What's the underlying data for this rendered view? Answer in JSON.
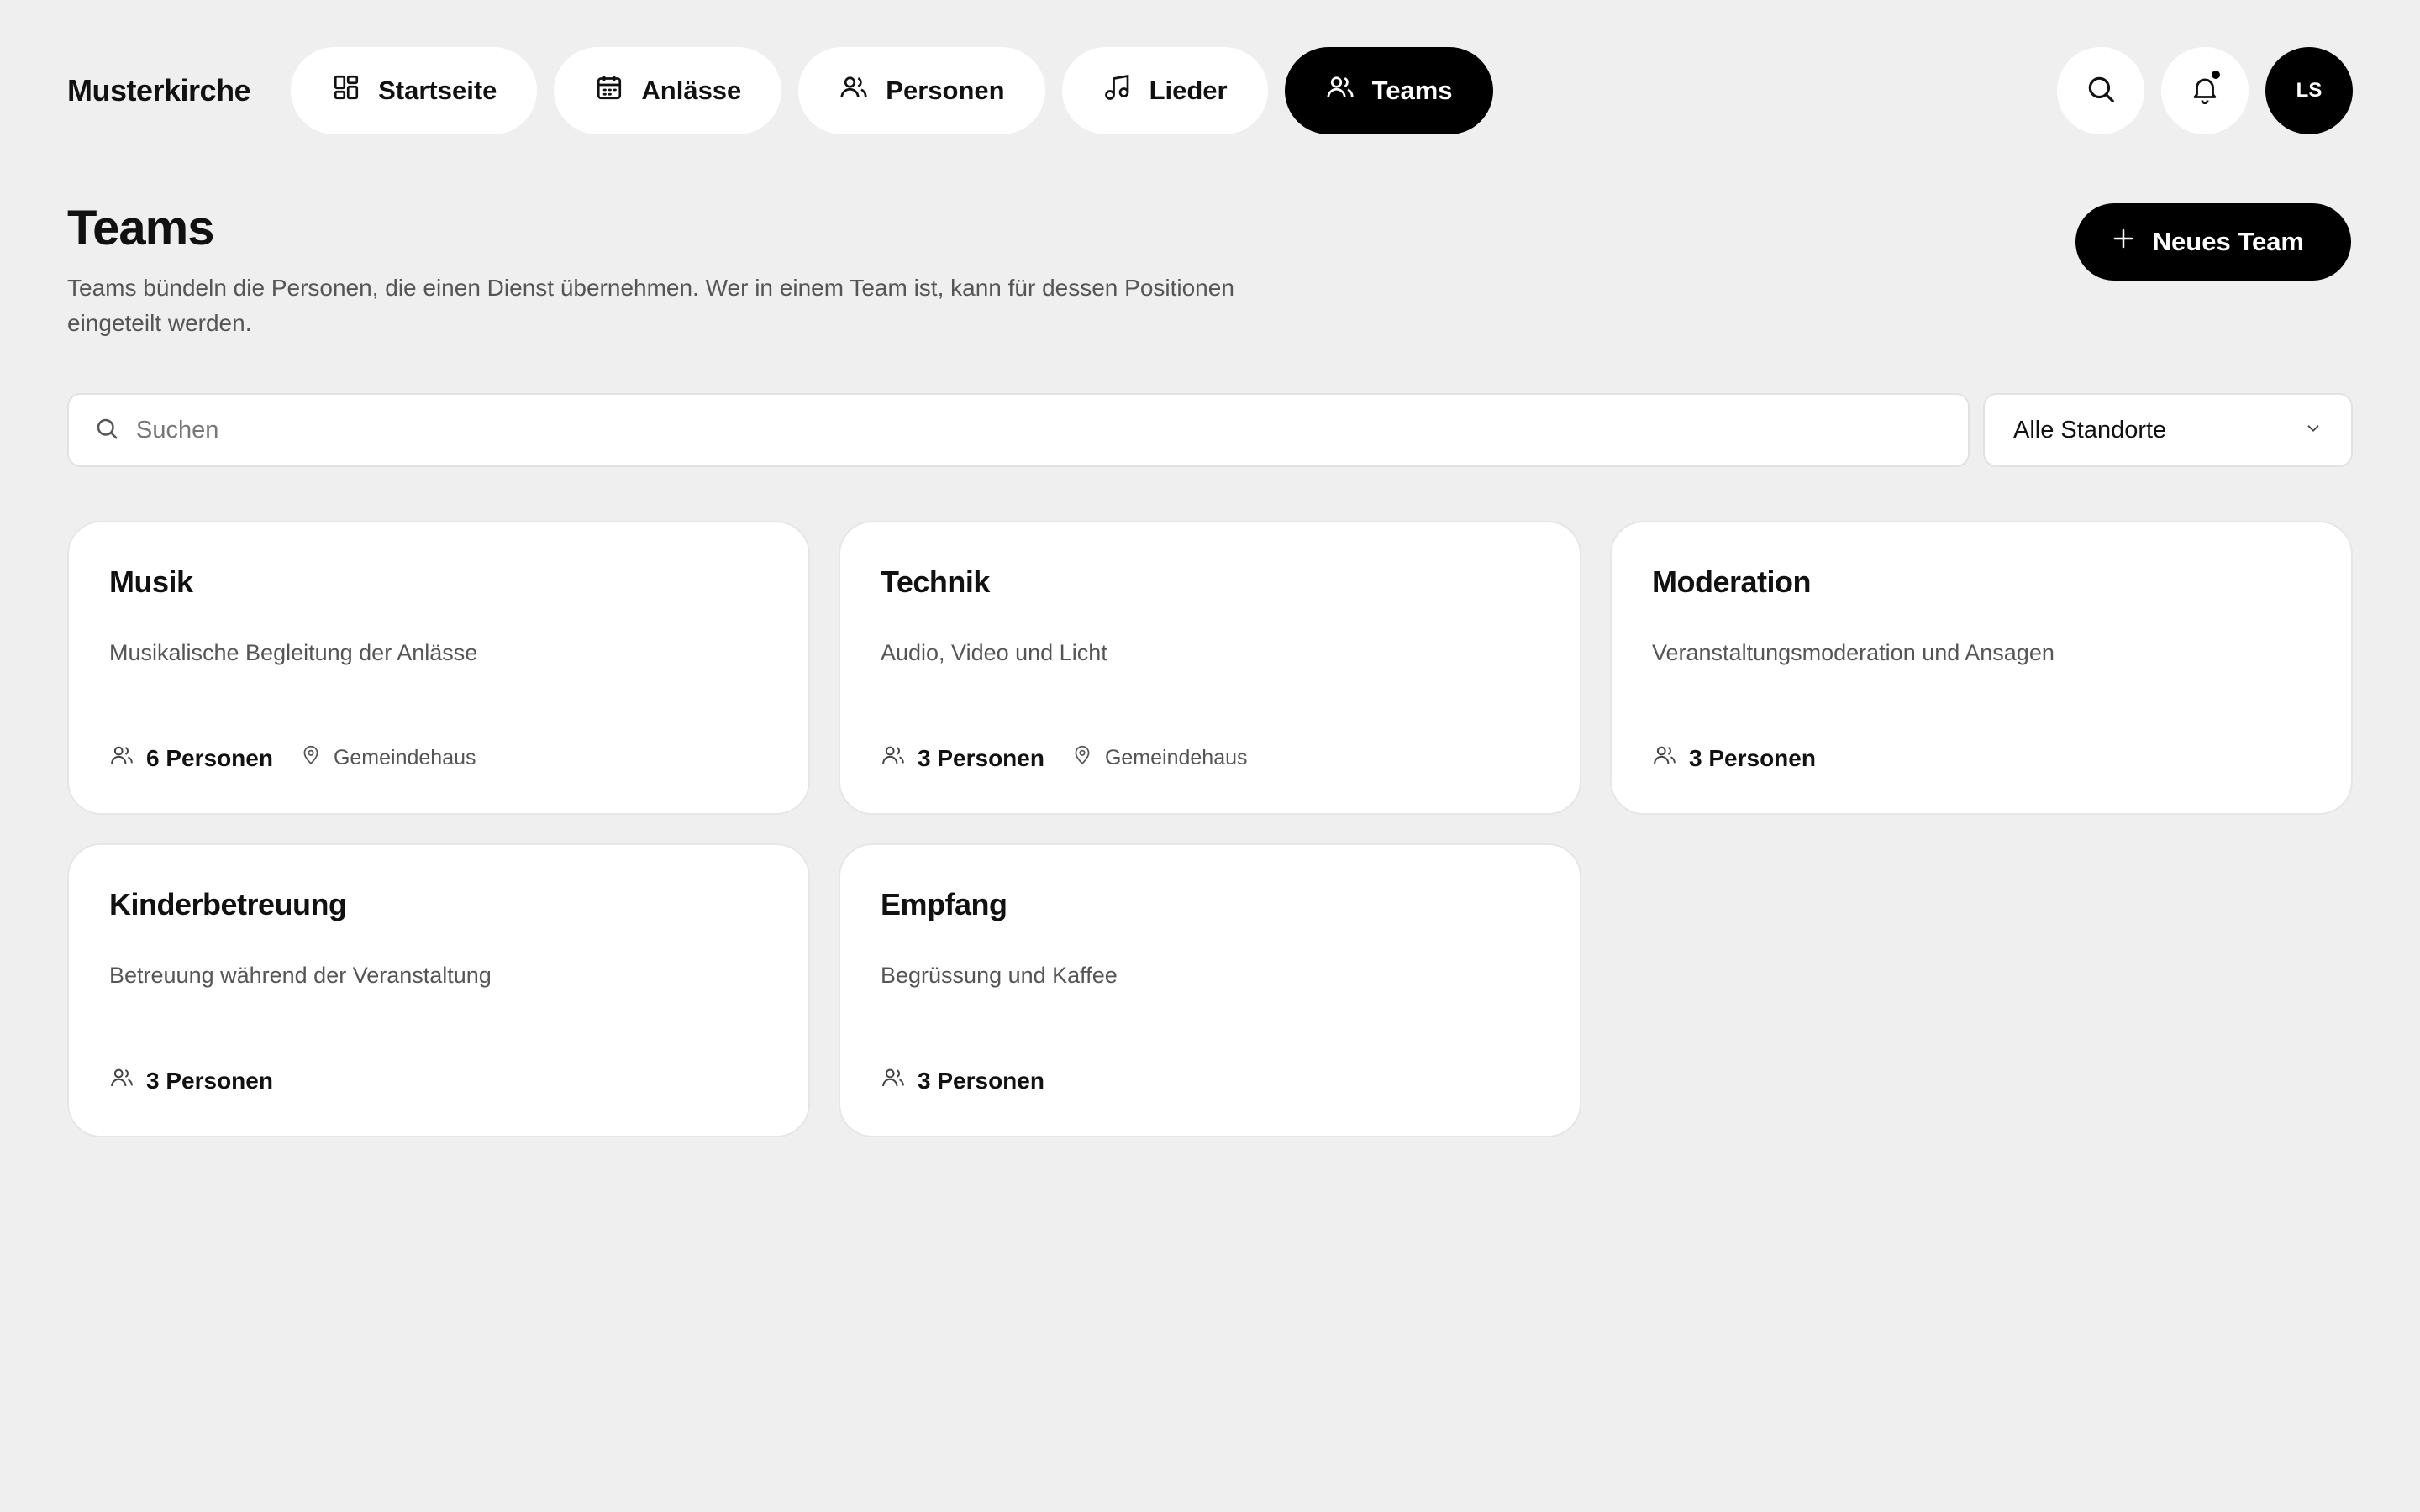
{
  "brand": "Musterkirche",
  "nav": [
    {
      "label": "Startseite",
      "icon": "dashboard-icon",
      "active": false
    },
    {
      "label": "Anlässe",
      "icon": "calendar-icon",
      "active": false
    },
    {
      "label": "Personen",
      "icon": "users-icon",
      "active": false
    },
    {
      "label": "Lieder",
      "icon": "music-icon",
      "active": false
    },
    {
      "label": "Teams",
      "icon": "users-icon",
      "active": true
    }
  ],
  "user": {
    "initials": "LS"
  },
  "header": {
    "title": "Teams",
    "description": "Teams bündeln die Personen, die einen Dienst übernehmen. Wer in einem Team ist, kann für dessen Positionen eingeteilt werden.",
    "new_button": "Neues Team"
  },
  "filters": {
    "search_placeholder": "Suchen",
    "location_selected": "Alle Standorte"
  },
  "teams": [
    {
      "name": "Musik",
      "description": "Musikalische Begleitung der Anlässe",
      "people": "6 Personen",
      "location": "Gemeindehaus"
    },
    {
      "name": "Technik",
      "description": "Audio, Video und Licht",
      "people": "3 Personen",
      "location": "Gemeindehaus"
    },
    {
      "name": "Moderation",
      "description": "Veranstaltungsmoderation und Ansagen",
      "people": "3 Personen",
      "location": ""
    },
    {
      "name": "Kinderbetreuung",
      "description": "Betreuung während der Veranstaltung",
      "people": "3 Personen",
      "location": ""
    },
    {
      "name": "Empfang",
      "description": "Begrüssung und Kaffee",
      "people": "3 Personen",
      "location": ""
    }
  ]
}
